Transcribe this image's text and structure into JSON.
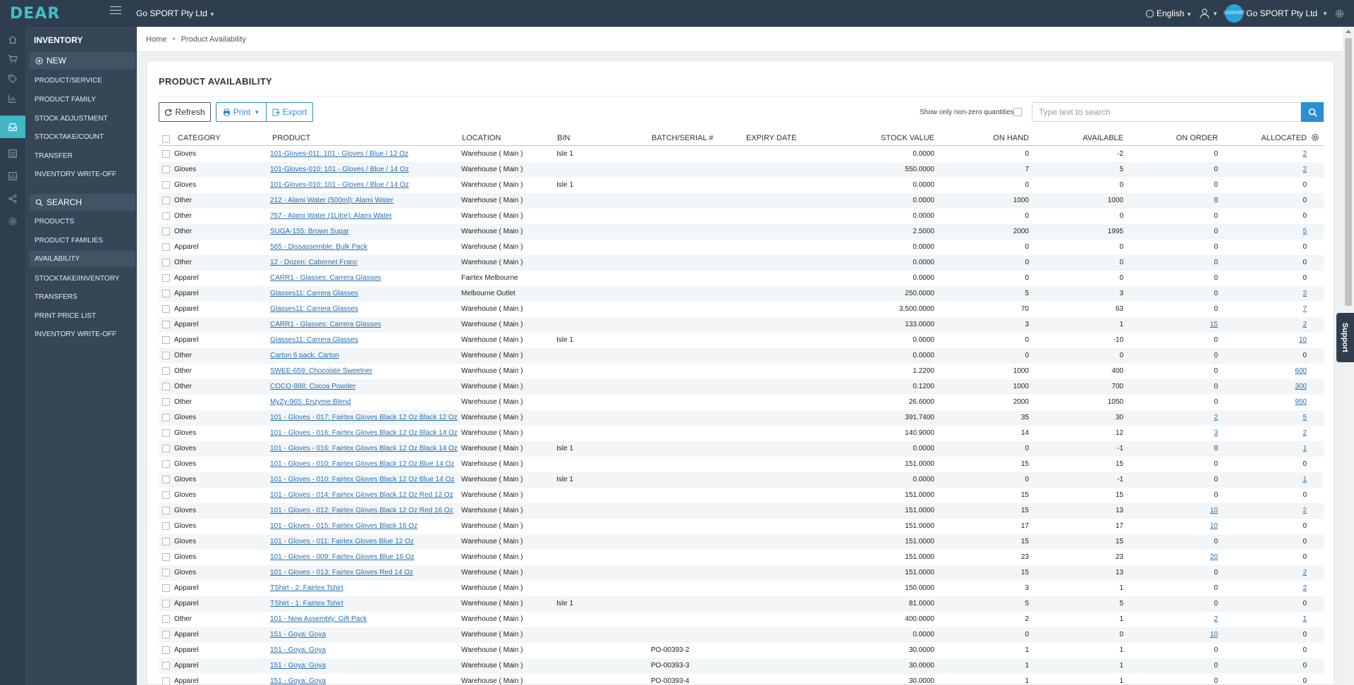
{
  "app": {
    "logo_text": "DEAR",
    "company": "Go SPORT Pty Ltd",
    "language": "English",
    "user_company": "Go SPORT Pty Ltd",
    "avatar_text": "GOSPORT"
  },
  "menu": {
    "title": "INVENTORY",
    "new_label": "NEW",
    "new_items": [
      "PRODUCT/SERVICE",
      "PRODUCT FAMILY",
      "STOCK ADJUSTMENT",
      "STOCKTAKE/COUNT",
      "TRANSFER",
      "INVENTORY WRITE-OFF"
    ],
    "search_label": "SEARCH",
    "search_items": [
      "PRODUCTS",
      "PRODUCT FAMILIES",
      "AVAILABILITY",
      "STOCKTAKE/INVENTORY",
      "TRANSFERS",
      "PRINT PRICE LIST",
      "INVENTORY WRITE-OFF"
    ],
    "active_item": "AVAILABILITY"
  },
  "breadcrumb": {
    "home": "Home",
    "current": "Product Availability"
  },
  "page": {
    "title": "PRODUCT AVAILABILITY",
    "refresh_label": "Refresh",
    "print_label": "Print",
    "export_label": "Export",
    "nonzero_label": "Show only non-zero quantities",
    "search_placeholder": "Type text to search"
  },
  "support_label": "Support",
  "table": {
    "columns": [
      "CATEGORY",
      "PRODUCT",
      "LOCATION",
      "BIN",
      "BATCH/SERIAL #",
      "EXPIRY DATE",
      "STOCK VALUE",
      "ON HAND",
      "AVAILABLE",
      "ON ORDER",
      "ALLOCATED"
    ],
    "rows": [
      {
        "category": "Gloves",
        "product": "101-Gloves-011: 101 - Gloves / Blue / 12 Oz",
        "location": "Warehouse ( Main )",
        "bin": "Isle 1",
        "batch": "",
        "expiry": "",
        "stock_value": "0.0000",
        "on_hand": "0",
        "available": "-2",
        "on_order": "0",
        "on_order_link": false,
        "allocated": "2",
        "allocated_link": true
      },
      {
        "category": "Gloves",
        "product": "101-Gloves-010: 101 - Gloves / Blue / 14 Oz",
        "location": "Warehouse ( Main )",
        "bin": "",
        "batch": "",
        "expiry": "",
        "stock_value": "550.0000",
        "on_hand": "7",
        "available": "5",
        "on_order": "0",
        "on_order_link": false,
        "allocated": "2",
        "allocated_link": true
      },
      {
        "category": "Gloves",
        "product": "101-Gloves-010: 101 - Gloves / Blue / 14 Oz",
        "location": "Warehouse ( Main )",
        "bin": "Isle 1",
        "batch": "",
        "expiry": "",
        "stock_value": "0.0000",
        "on_hand": "0",
        "available": "0",
        "on_order": "0",
        "on_order_link": false,
        "allocated": "0",
        "allocated_link": false
      },
      {
        "category": "Other",
        "product": "212 - Alami Water (500ml): Alami Water",
        "location": "Warehouse ( Main )",
        "bin": "",
        "batch": "",
        "expiry": "",
        "stock_value": "0.0000",
        "on_hand": "1000",
        "available": "1000",
        "on_order": "0",
        "on_order_link": false,
        "allocated": "0",
        "allocated_link": false
      },
      {
        "category": "Other",
        "product": "757 - Alami Water (1Litre): Alami Water",
        "location": "Warehouse ( Main )",
        "bin": "",
        "batch": "",
        "expiry": "",
        "stock_value": "0.0000",
        "on_hand": "0",
        "available": "0",
        "on_order": "0",
        "on_order_link": false,
        "allocated": "0",
        "allocated_link": false
      },
      {
        "category": "Other",
        "product": "SUGA-155: Brown Sugar",
        "location": "Warehouse ( Main )",
        "bin": "",
        "batch": "",
        "expiry": "",
        "stock_value": "2.5000",
        "on_hand": "2000",
        "available": "1995",
        "on_order": "0",
        "on_order_link": false,
        "allocated": "5",
        "allocated_link": true
      },
      {
        "category": "Apparel",
        "product": "565 - Dissassemble: Bulk Pack",
        "location": "Warehouse ( Main )",
        "bin": "",
        "batch": "",
        "expiry": "",
        "stock_value": "0.0000",
        "on_hand": "0",
        "available": "0",
        "on_order": "0",
        "on_order_link": false,
        "allocated": "0",
        "allocated_link": false
      },
      {
        "category": "Other",
        "product": "12 - Dozen: Cabernet Franc",
        "location": "Warehouse ( Main )",
        "bin": "",
        "batch": "",
        "expiry": "",
        "stock_value": "0.0000",
        "on_hand": "0",
        "available": "0",
        "on_order": "0",
        "on_order_link": false,
        "allocated": "0",
        "allocated_link": false
      },
      {
        "category": "Apparel",
        "product": "CARR1 - Glasses: Carrera Glasses",
        "location": "Fairtex Melbourne",
        "bin": "",
        "batch": "",
        "expiry": "",
        "stock_value": "0.0000",
        "on_hand": "0",
        "available": "0",
        "on_order": "0",
        "on_order_link": false,
        "allocated": "0",
        "allocated_link": false
      },
      {
        "category": "Apparel",
        "product": "Glasses11: Carrera Glasses",
        "location": "Melbourne Outlet",
        "bin": "",
        "batch": "",
        "expiry": "",
        "stock_value": "250.0000",
        "on_hand": "5",
        "available": "3",
        "on_order": "0",
        "on_order_link": false,
        "allocated": "2",
        "allocated_link": true
      },
      {
        "category": "Apparel",
        "product": "Glasses11: Carrera Glasses",
        "location": "Warehouse ( Main )",
        "bin": "",
        "batch": "",
        "expiry": "",
        "stock_value": "3,500.0000",
        "on_hand": "70",
        "available": "63",
        "on_order": "0",
        "on_order_link": false,
        "allocated": "7",
        "allocated_link": true
      },
      {
        "category": "Apparel",
        "product": "CARR1 - Glasses: Carrera Glasses",
        "location": "Warehouse ( Main )",
        "bin": "",
        "batch": "",
        "expiry": "",
        "stock_value": "133.0000",
        "on_hand": "3",
        "available": "1",
        "on_order": "15",
        "on_order_link": true,
        "allocated": "2",
        "allocated_link": true
      },
      {
        "category": "Apparel",
        "product": "Glasses11: Carrera Glasses",
        "location": "Warehouse ( Main )",
        "bin": "Isle 1",
        "batch": "",
        "expiry": "",
        "stock_value": "0.0000",
        "on_hand": "0",
        "available": "-10",
        "on_order": "0",
        "on_order_link": false,
        "allocated": "10",
        "allocated_link": true
      },
      {
        "category": "Other",
        "product": "Carton 6 pack: Carton",
        "location": "Warehouse ( Main )",
        "bin": "",
        "batch": "",
        "expiry": "",
        "stock_value": "0.0000",
        "on_hand": "0",
        "available": "0",
        "on_order": "0",
        "on_order_link": false,
        "allocated": "0",
        "allocated_link": false
      },
      {
        "category": "Other",
        "product": "SWEE-659: Chocolate Sweetner",
        "location": "Warehouse ( Main )",
        "bin": "",
        "batch": "",
        "expiry": "",
        "stock_value": "1.2200",
        "on_hand": "1000",
        "available": "400",
        "on_order": "0",
        "on_order_link": false,
        "allocated": "600",
        "allocated_link": true
      },
      {
        "category": "Other",
        "product": "COCO-888: Cocoa Powder",
        "location": "Warehouse ( Main )",
        "bin": "",
        "batch": "",
        "expiry": "",
        "stock_value": "0.1200",
        "on_hand": "1000",
        "available": "700",
        "on_order": "0",
        "on_order_link": false,
        "allocated": "300",
        "allocated_link": true
      },
      {
        "category": "Other",
        "product": "MyZy-965: Enzyme Blend",
        "location": "Warehouse ( Main )",
        "bin": "",
        "batch": "",
        "expiry": "",
        "stock_value": "26.6000",
        "on_hand": "2000",
        "available": "1050",
        "on_order": "0",
        "on_order_link": false,
        "allocated": "950",
        "allocated_link": true
      },
      {
        "category": "Gloves",
        "product": "101 - Gloves - 017: Fairtex Gloves Black 12 Oz Black 12 Oz",
        "location": "Warehouse ( Main )",
        "bin": "",
        "batch": "",
        "expiry": "",
        "stock_value": "391.7400",
        "on_hand": "35",
        "available": "30",
        "on_order": "2",
        "on_order_link": true,
        "allocated": "5",
        "allocated_link": true
      },
      {
        "category": "Gloves",
        "product": "101 - Gloves - 016: Fairtex Gloves Black 12 Oz Black 14 Oz",
        "location": "Warehouse ( Main )",
        "bin": "",
        "batch": "",
        "expiry": "",
        "stock_value": "140.9000",
        "on_hand": "14",
        "available": "12",
        "on_order": "3",
        "on_order_link": true,
        "allocated": "2",
        "allocated_link": true
      },
      {
        "category": "Gloves",
        "product": "101 - Gloves - 016: Fairtex Gloves Black 12 Oz Black 14 Oz",
        "location": "Warehouse ( Main )",
        "bin": "Isle 1",
        "batch": "",
        "expiry": "",
        "stock_value": "0.0000",
        "on_hand": "0",
        "available": "-1",
        "on_order": "0",
        "on_order_link": false,
        "allocated": "1",
        "allocated_link": true
      },
      {
        "category": "Gloves",
        "product": "101 - Gloves - 010: Fairtex Gloves Black 12 Oz Blue 14 Oz",
        "location": "Warehouse ( Main )",
        "bin": "",
        "batch": "",
        "expiry": "",
        "stock_value": "151.0000",
        "on_hand": "15",
        "available": "15",
        "on_order": "0",
        "on_order_link": false,
        "allocated": "0",
        "allocated_link": false
      },
      {
        "category": "Gloves",
        "product": "101 - Gloves - 010: Fairtex Gloves Black 12 Oz Blue 14 Oz",
        "location": "Warehouse ( Main )",
        "bin": "Isle 1",
        "batch": "",
        "expiry": "",
        "stock_value": "0.0000",
        "on_hand": "0",
        "available": "-1",
        "on_order": "0",
        "on_order_link": false,
        "allocated": "1",
        "allocated_link": true
      },
      {
        "category": "Gloves",
        "product": "101 - Gloves - 014: Fairtex Gloves Black 12 Oz Red 12 Oz",
        "location": "Warehouse ( Main )",
        "bin": "",
        "batch": "",
        "expiry": "",
        "stock_value": "151.0000",
        "on_hand": "15",
        "available": "15",
        "on_order": "0",
        "on_order_link": false,
        "allocated": "0",
        "allocated_link": false
      },
      {
        "category": "Gloves",
        "product": "101 - Gloves - 012: Fairtex Gloves Black 12 Oz Red 16 Oz",
        "location": "Warehouse ( Main )",
        "bin": "",
        "batch": "",
        "expiry": "",
        "stock_value": "151.0000",
        "on_hand": "15",
        "available": "13",
        "on_order": "10",
        "on_order_link": true,
        "allocated": "2",
        "allocated_link": true
      },
      {
        "category": "Gloves",
        "product": "101 - Gloves - 015: Fairtex Gloves Black 16 Oz",
        "location": "Warehouse ( Main )",
        "bin": "",
        "batch": "",
        "expiry": "",
        "stock_value": "151.0000",
        "on_hand": "17",
        "available": "17",
        "on_order": "10",
        "on_order_link": true,
        "allocated": "0",
        "allocated_link": false
      },
      {
        "category": "Gloves",
        "product": "101 - Gloves - 011: Fairtex Gloves Blue 12 Oz",
        "location": "Warehouse ( Main )",
        "bin": "",
        "batch": "",
        "expiry": "",
        "stock_value": "151.0000",
        "on_hand": "15",
        "available": "15",
        "on_order": "0",
        "on_order_link": false,
        "allocated": "0",
        "allocated_link": false
      },
      {
        "category": "Gloves",
        "product": "101 - Gloves - 009: Fairtex Gloves Blue 16 Oz",
        "location": "Warehouse ( Main )",
        "bin": "",
        "batch": "",
        "expiry": "",
        "stock_value": "151.0000",
        "on_hand": "23",
        "available": "23",
        "on_order": "20",
        "on_order_link": true,
        "allocated": "0",
        "allocated_link": false
      },
      {
        "category": "Gloves",
        "product": "101 - Gloves - 013: Fairtex Gloves Red 14 Oz",
        "location": "Warehouse ( Main )",
        "bin": "",
        "batch": "",
        "expiry": "",
        "stock_value": "151.0000",
        "on_hand": "15",
        "available": "13",
        "on_order": "0",
        "on_order_link": false,
        "allocated": "2",
        "allocated_link": true
      },
      {
        "category": "Apparel",
        "product": "TShirt - 2: Fairtex Tshirt",
        "location": "Warehouse ( Main )",
        "bin": "",
        "batch": "",
        "expiry": "",
        "stock_value": "150.0000",
        "on_hand": "3",
        "available": "1",
        "on_order": "0",
        "on_order_link": false,
        "allocated": "2",
        "allocated_link": true
      },
      {
        "category": "Apparel",
        "product": "TShirt - 1: Fairtex Tshirt",
        "location": "Warehouse ( Main )",
        "bin": "Isle 1",
        "batch": "",
        "expiry": "",
        "stock_value": "81.0000",
        "on_hand": "5",
        "available": "5",
        "on_order": "0",
        "on_order_link": false,
        "allocated": "0",
        "allocated_link": false
      },
      {
        "category": "Other",
        "product": "101 - New Assembly: Gift Pack",
        "location": "Warehouse ( Main )",
        "bin": "",
        "batch": "",
        "expiry": "",
        "stock_value": "400.0000",
        "on_hand": "2",
        "available": "1",
        "on_order": "2",
        "on_order_link": true,
        "allocated": "1",
        "allocated_link": true
      },
      {
        "category": "Apparel",
        "product": "151 - Goya: Goya",
        "location": "Warehouse ( Main )",
        "bin": "",
        "batch": "",
        "expiry": "",
        "stock_value": "0.0000",
        "on_hand": "0",
        "available": "0",
        "on_order": "10",
        "on_order_link": true,
        "allocated": "0",
        "allocated_link": false
      },
      {
        "category": "Apparel",
        "product": "151 - Goya: Goya",
        "location": "Warehouse ( Main )",
        "bin": "",
        "batch": "PO-00393-2",
        "expiry": "",
        "stock_value": "30.0000",
        "on_hand": "1",
        "available": "1",
        "on_order": "0",
        "on_order_link": false,
        "allocated": "0",
        "allocated_link": false
      },
      {
        "category": "Apparel",
        "product": "151 - Goya: Goya",
        "location": "Warehouse ( Main )",
        "bin": "",
        "batch": "PO-00393-3",
        "expiry": "",
        "stock_value": "30.0000",
        "on_hand": "1",
        "available": "1",
        "on_order": "0",
        "on_order_link": false,
        "allocated": "0",
        "allocated_link": false
      },
      {
        "category": "Apparel",
        "product": "151 - Goya: Goya",
        "location": "Warehouse ( Main )",
        "bin": "",
        "batch": "PO-00393-4",
        "expiry": "",
        "stock_value": "30.0000",
        "on_hand": "1",
        "available": "1",
        "on_order": "0",
        "on_order_link": false,
        "allocated": "0",
        "allocated_link": false
      }
    ]
  },
  "colors": {
    "topbar": "#2f3e4e",
    "accent": "#3fb8c4",
    "link": "#2a6fb0",
    "primary": "#2a8fd0"
  },
  "icons": [
    "home-icon",
    "cart-icon",
    "tag-icon",
    "chart-icon",
    "inbox-icon",
    "list-icon",
    "bar-chart-icon",
    "share-icon",
    "gear-icon",
    "search-icon",
    "refresh-icon",
    "print-icon",
    "export-icon",
    "globe-icon",
    "user-icon",
    "plus-circle-icon"
  ]
}
